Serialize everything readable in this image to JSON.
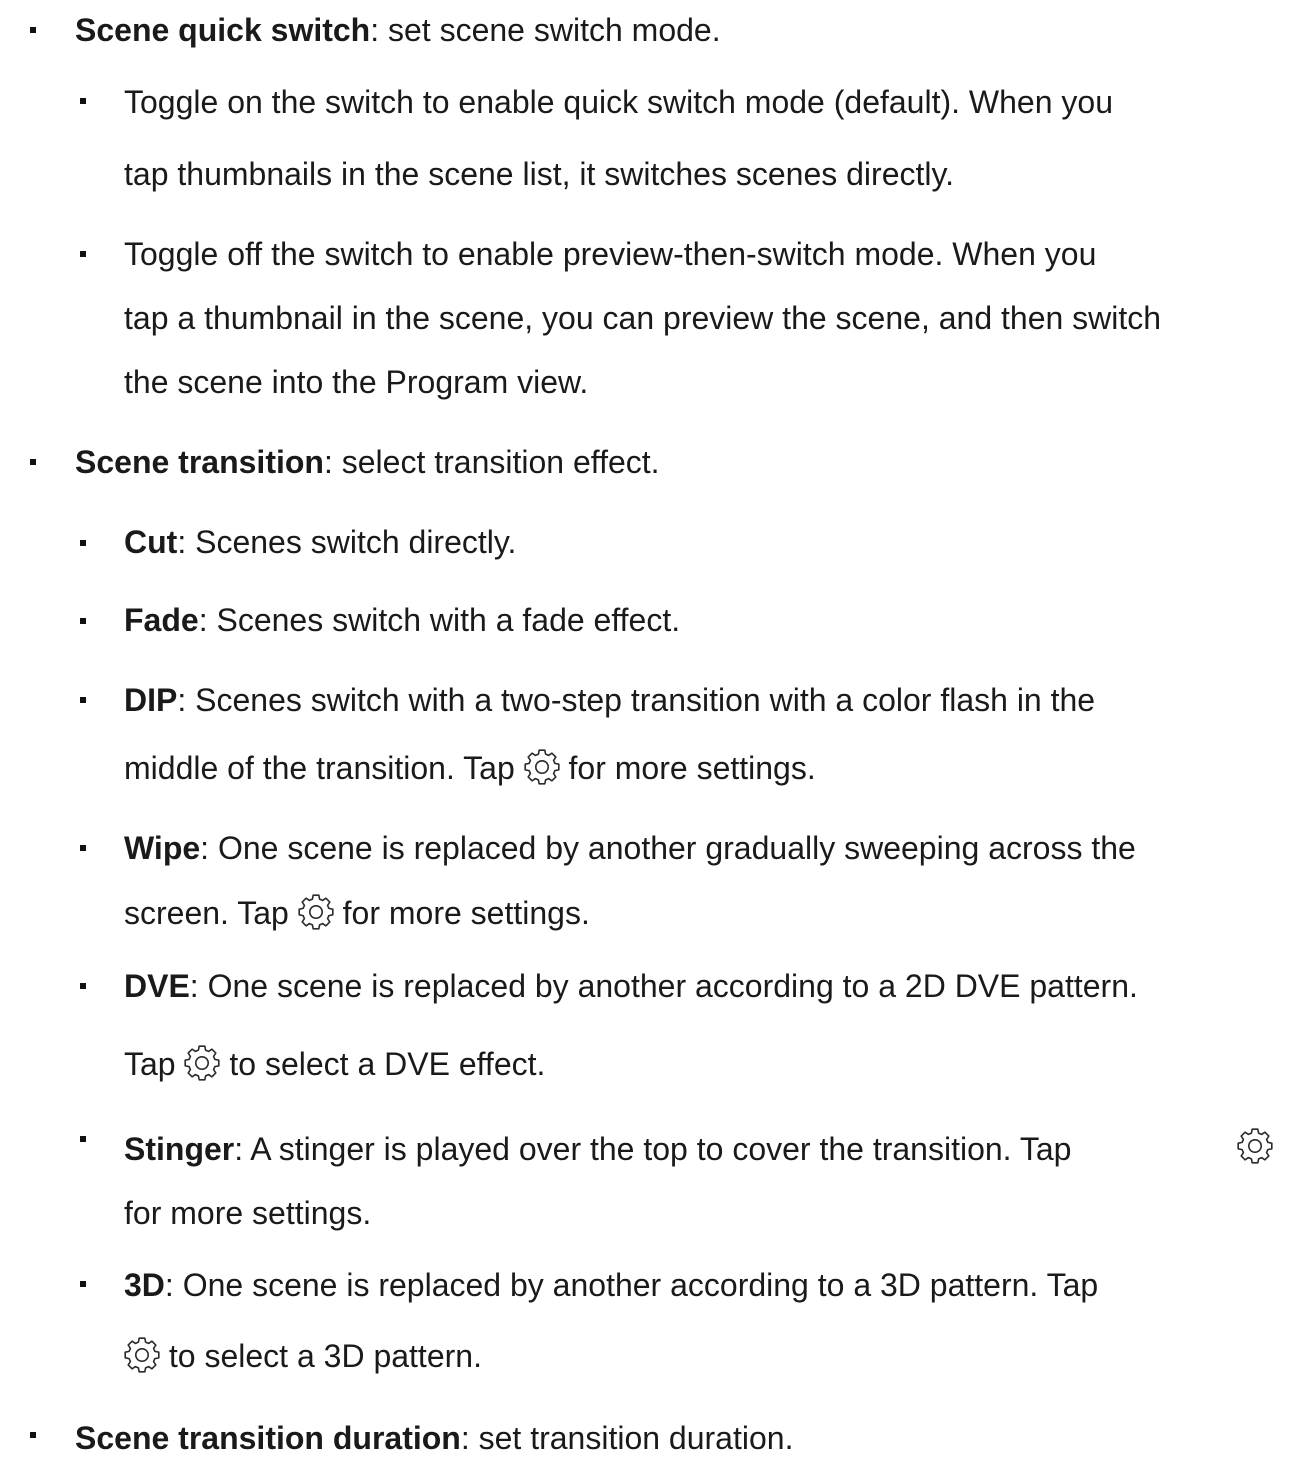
{
  "items": {
    "quick_switch": {
      "term": "Scene quick switch",
      "desc": ": set scene switch mode.",
      "sub_on": {
        "line1": "Toggle on the switch to enable quick switch mode (default). When you",
        "line2": "tap thumbnails in the scene list, it switches scenes directly."
      },
      "sub_off": {
        "line1": "Toggle off the switch to enable preview-then-switch mode. When you",
        "line2": "tap a thumbnail in the scene, you can preview the scene, and then switch",
        "line3": "the scene into the Program view."
      }
    },
    "transition": {
      "term": "Scene transition",
      "desc": ": select transition effect.",
      "cut": {
        "term": "Cut",
        "desc": ": Scenes switch directly."
      },
      "fade": {
        "term": "Fade",
        "desc": ": Scenes switch with a fade effect."
      },
      "dip": {
        "term": "DIP",
        "desc": ": Scenes switch with a two-step transition with a color flash in the",
        "line2_before": "middle of the transition. Tap ",
        "line2_after": " for more settings."
      },
      "wipe": {
        "term": "Wipe",
        "desc": ": One scene is replaced by another gradually sweeping across the",
        "line2_before": "screen. Tap ",
        "line2_after": " for more settings."
      },
      "dve": {
        "term": "DVE",
        "desc": ": One scene is replaced by another according to a 2D DVE pattern.",
        "line2_before": "Tap ",
        "line2_after": " to select a DVE effect."
      },
      "stinger": {
        "term": "Stinger",
        "desc": ": A stinger is played over the top to cover the transition. Tap",
        "line2": "for more settings."
      },
      "three_d": {
        "term": "3D",
        "desc": ": One scene is replaced by another according to a 3D pattern. Tap",
        "line2_after": " to select a 3D pattern."
      }
    },
    "duration": {
      "term": "Scene transition duration",
      "desc": ": set transition duration."
    }
  },
  "icons": {
    "bullet": "square-bullet",
    "settings": "gear-icon"
  }
}
